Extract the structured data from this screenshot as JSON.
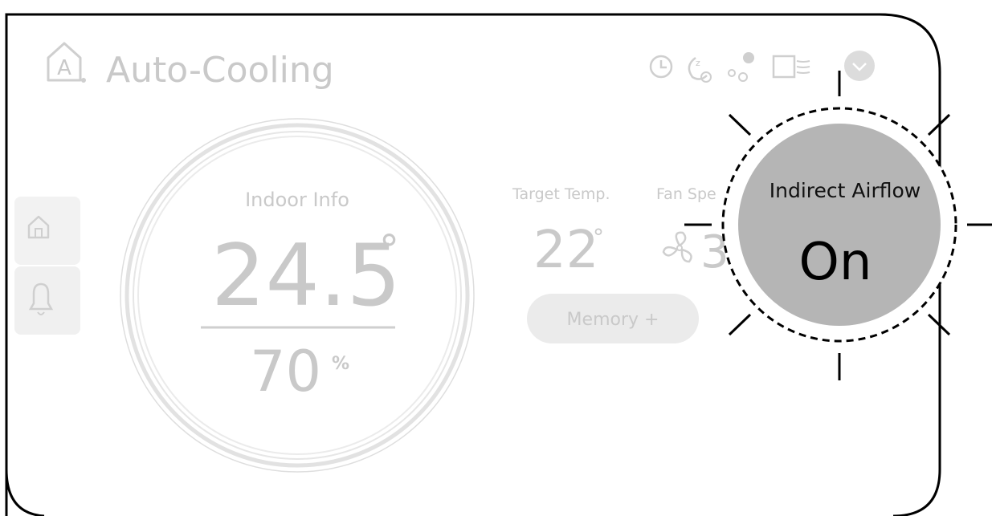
{
  "header": {
    "mode_title": "Auto-Cooling",
    "mode_badge": "A"
  },
  "indoor": {
    "label": "Indoor Info",
    "temperature": "24.5",
    "temperature_unit": "°",
    "humidity": "70",
    "humidity_unit": "%"
  },
  "target": {
    "label": "Target Temp.",
    "value": "22",
    "unit": "°"
  },
  "fan": {
    "label": "Fan Spe",
    "value": "3"
  },
  "memory_button": {
    "label": "Memory +"
  },
  "popup": {
    "title": "Indirect Airflow",
    "state": "On"
  },
  "colors": {
    "faded": "#c9c9c9",
    "popup_fill": "#b5b5b5",
    "frame": "#000000"
  }
}
